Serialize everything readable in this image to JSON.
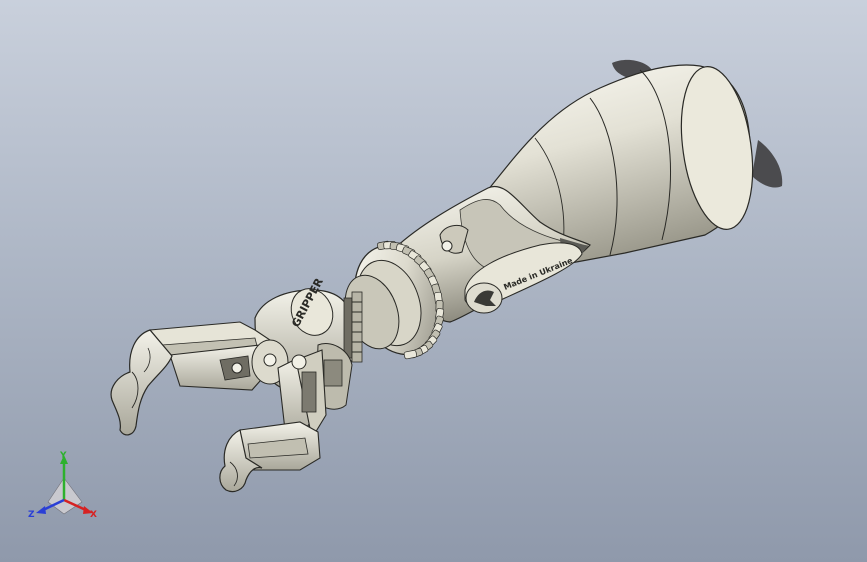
{
  "model": {
    "wrist_text": "GRIPPER",
    "forearm_text": "Made in Ukraine"
  },
  "triad": {
    "axes": [
      {
        "label": "Y",
        "color": "#2db12d"
      },
      {
        "label": "X",
        "color": "#d62222"
      },
      {
        "label": "Z",
        "color": "#2a3fd6"
      }
    ]
  },
  "colors": {
    "metal_light": "#f1f0e6",
    "metal_mid": "#d4d2c4",
    "metal_dark": "#8f8d80",
    "edge": "#2a2a26"
  }
}
